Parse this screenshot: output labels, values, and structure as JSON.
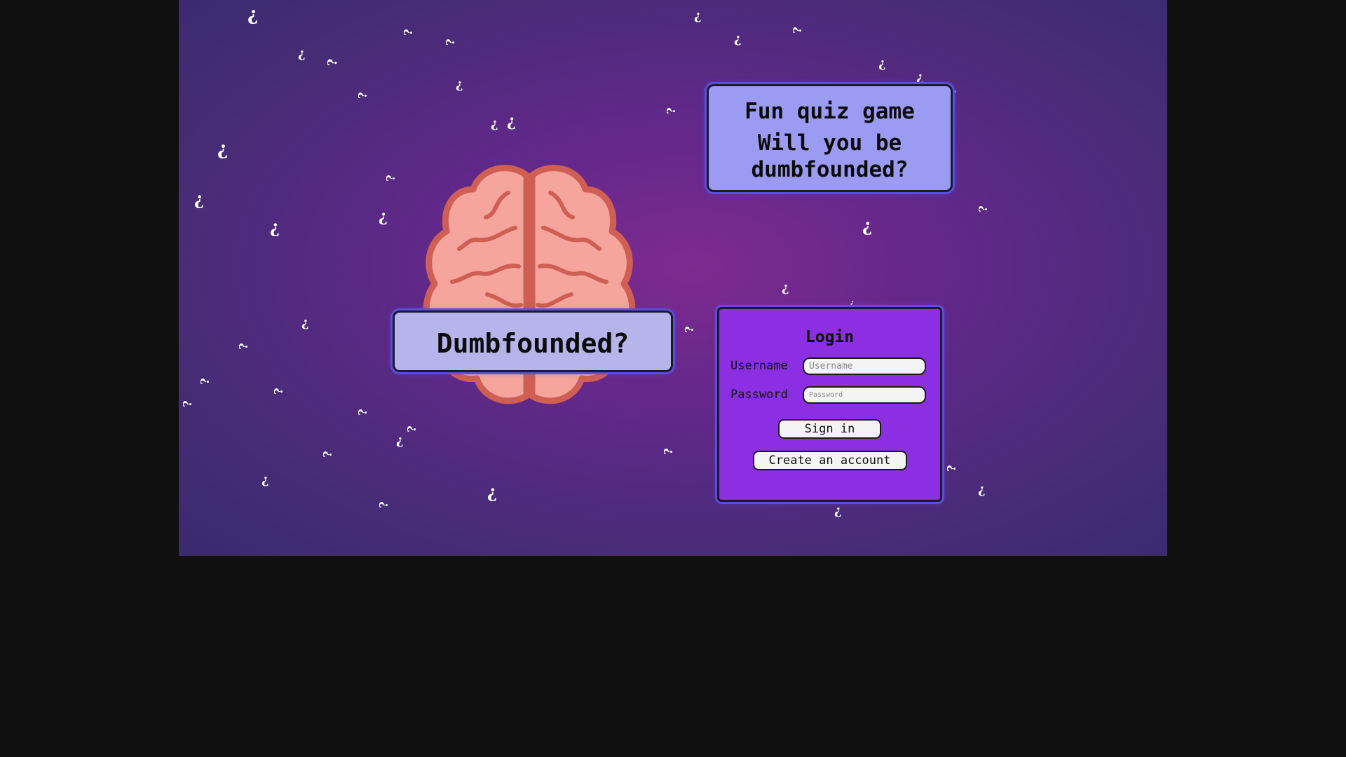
{
  "title_card": {
    "title": "Dumbfounded?"
  },
  "tagline_card": {
    "line1": "Fun quiz game",
    "line2": "Will you be",
    "line3": "dumbfounded?"
  },
  "login": {
    "heading": "Login",
    "username_label": "Username",
    "username_placeholder": "Username",
    "password_label": "Password",
    "password_placeholder": "Password",
    "sign_in_label": "Sign in",
    "create_account_label": "Create an account"
  },
  "background": {
    "glyph": "¿",
    "colors": {
      "center": "#7e2a8f",
      "edge": "#3a2a6e",
      "outer": "#101010"
    }
  },
  "colors": {
    "title_card": "#b7b4ec",
    "tagline_card": "#9b9bf3",
    "login_card": "#8c2fe3",
    "card_glow": "#5a4ee0"
  },
  "icons": {
    "brain": "brain-icon",
    "decoration": "question-mark-icon"
  }
}
